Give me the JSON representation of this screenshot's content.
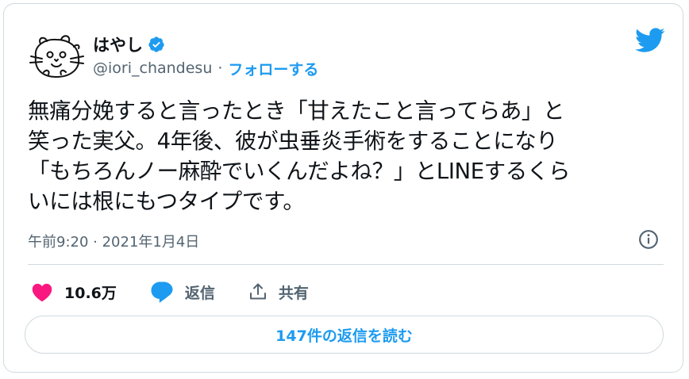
{
  "author": {
    "display_name": "はやし",
    "handle": "@iori_chandesu",
    "separator": "·",
    "follow_label": "フォローする",
    "verified_icon": "verified-badge-icon",
    "avatar": "cartoon-hamster-avatar"
  },
  "tweet": {
    "text": "無痛分娩すると言ったとき「甘えたこと言ってらあ」と\n笑った実父。4年後、彼が虫垂炎手術をすることになり\n「もちろんノー麻酔でいくんだよね？」とLINEするくら\nいには根にもつタイプです。",
    "timestamp": "午前9:20 · 2021年1月4日"
  },
  "actions": {
    "like_count": "10.6万",
    "reply_label": "返信",
    "share_label": "共有"
  },
  "read_replies_label": "147件の返信を読む",
  "colors": {
    "accent": "#1d9bf0",
    "like": "#f91880",
    "text": "#0f1419",
    "secondary": "#536471",
    "border": "#cfd9de"
  },
  "icons": [
    "twitter-bird-icon",
    "info-icon",
    "heart-icon",
    "reply-bubble-icon",
    "share-icon"
  ]
}
